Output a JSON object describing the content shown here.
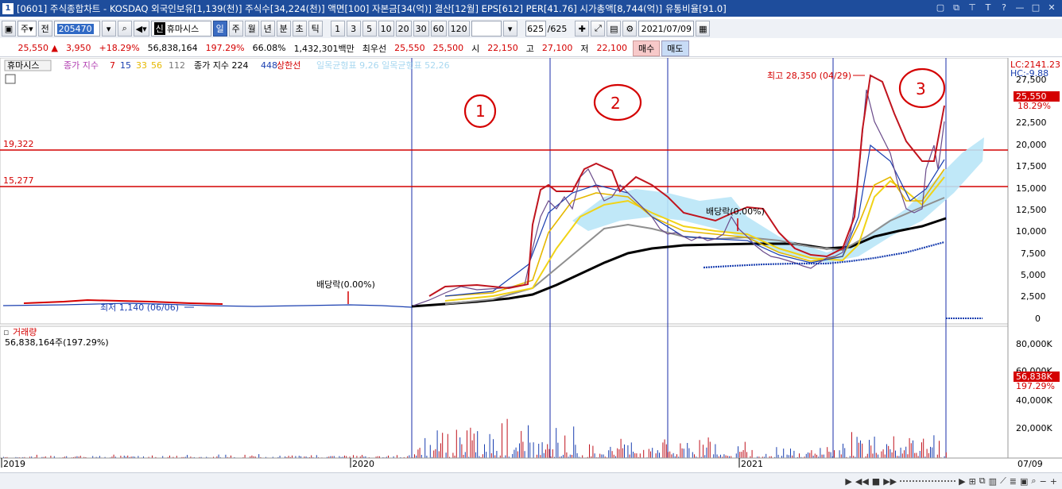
{
  "window": {
    "title": "[0601] 주식종합차트 - KOSDAQ 외국인보유[1,139(천)] 주식수[34,224(천)] 액면[100] 자본금[34(억)] 결산[12월] EPS[612] PER[41.76] 시가총액[8,744(억)] 유통비율[91.0]",
    "icon_label": "1"
  },
  "toolbar": {
    "market": "주",
    "prev_label": "전",
    "code": "205470",
    "name": "휴마시스",
    "name_prefix": "신",
    "periods": [
      "일",
      "주",
      "월",
      "년",
      "분",
      "초",
      "틱"
    ],
    "intervals": [
      "1",
      "3",
      "5",
      "10",
      "20",
      "30",
      "60",
      "120"
    ],
    "count": "625",
    "count_total": "/625",
    "date": "2021/07/09"
  },
  "quote": {
    "price": "25,550 ▲",
    "change": "3,950",
    "change_pct": "+18.29%",
    "volume": "56,838,164",
    "volume_pct": "197.29%",
    "turnover": "66.08%",
    "amount": "1,432,301백만",
    "sell_price_label": "최우선",
    "ask": "25,550",
    "bid": "25,500",
    "open_label": "시",
    "open": "22,150",
    "high_label": "고",
    "high": "27,100",
    "low_label": "저",
    "low": "22,100",
    "buy_button": "매수",
    "sell_button": "매도"
  },
  "legend": {
    "name": "휴마시스",
    "ma_label": "종가 지수",
    "ma_values": [
      "7",
      "15",
      "33",
      "56",
      "112"
    ],
    "ma2_label": "종가 지수 224",
    "ma2_value": "448",
    "limit_label": "상한선",
    "faint_text": "일목균형표 9,26 일목균형표 52,26"
  },
  "price_axis": {
    "labels": [
      "27,500",
      "25,000",
      "22,500",
      "20,000",
      "17,500",
      "15,000",
      "12,500",
      "10,000",
      "7,500",
      "5,000",
      "2,500",
      "0"
    ],
    "lc": "LC:2141.23",
    "hc": "HC:-9.88",
    "current": "25,550",
    "current_pct": "18.29%"
  },
  "levels": [
    {
      "label": "19,322"
    },
    {
      "label": "15,277"
    }
  ],
  "annotations": {
    "high": "최고 28,350 (04/29)",
    "low": "최저 1,140 (06/06)",
    "dividend1": "배당락(0.00%)",
    "dividend2": "배당락(0.00%)",
    "marks": [
      "1",
      "2",
      "3"
    ]
  },
  "volume_panel": {
    "title": "거래량",
    "value": "56,838,164주(197.29%)",
    "axis_labels": [
      "80,000K",
      "60,000K",
      "40,000K",
      "20,000K"
    ],
    "current": "56,838K",
    "current_pct": "197.29%"
  },
  "x_axis": {
    "labels": [
      "2019",
      "2020",
      "2021"
    ],
    "end": "07/09"
  },
  "colors": {
    "title_bg": "#1e4d9c",
    "up": "#d40000",
    "down": "#1a3fb0",
    "level_line": "#d40000"
  }
}
